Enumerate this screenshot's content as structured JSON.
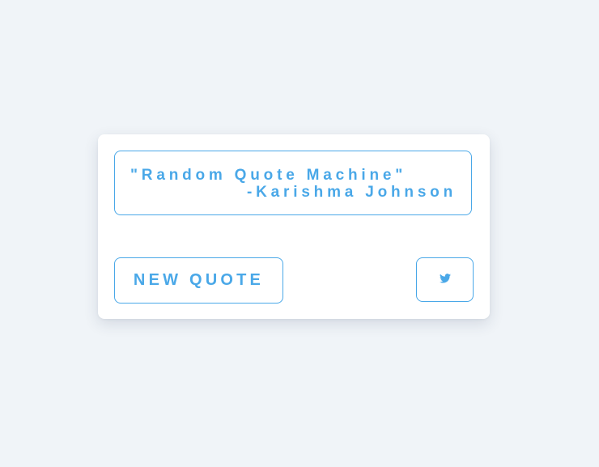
{
  "quote": {
    "text": "\"Random Quote Machine\"",
    "author": "-Karishma Johnson"
  },
  "actions": {
    "new_quote_label": "NEW QUOTE",
    "tweet_icon": "twitter-icon"
  },
  "colors": {
    "accent": "#4aa8e8",
    "background": "#f0f4f8",
    "card": "#ffffff"
  }
}
